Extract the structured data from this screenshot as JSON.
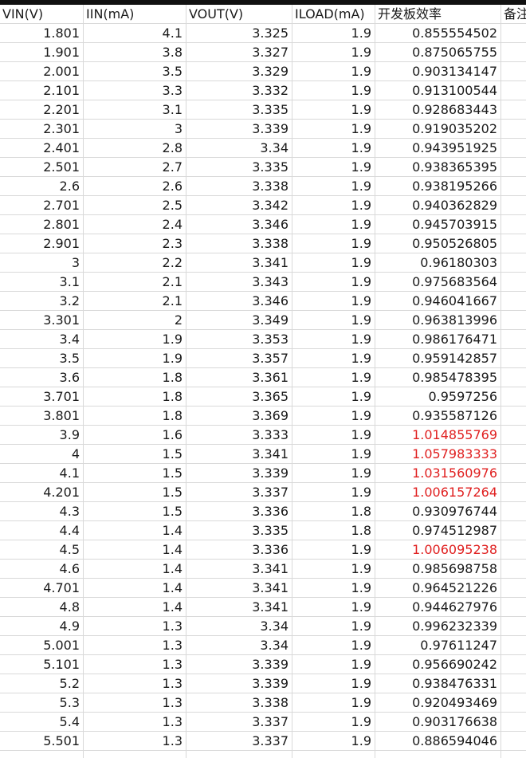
{
  "headers": [
    "VIN(V)",
    "IIN(mA)",
    "VOUT(V)",
    "ILOAD(mA)",
    "开发板效率",
    "备注"
  ],
  "highlight_color": "#e02020",
  "rows": [
    {
      "vin": "1.801",
      "iin": "4.1",
      "vout": "3.325",
      "iload": "1.9",
      "eff": "0.855554502",
      "highlight": false
    },
    {
      "vin": "1.901",
      "iin": "3.8",
      "vout": "3.327",
      "iload": "1.9",
      "eff": "0.875065755",
      "highlight": false
    },
    {
      "vin": "2.001",
      "iin": "3.5",
      "vout": "3.329",
      "iload": "1.9",
      "eff": "0.903134147",
      "highlight": false
    },
    {
      "vin": "2.101",
      "iin": "3.3",
      "vout": "3.332",
      "iload": "1.9",
      "eff": "0.913100544",
      "highlight": false
    },
    {
      "vin": "2.201",
      "iin": "3.1",
      "vout": "3.335",
      "iload": "1.9",
      "eff": "0.928683443",
      "highlight": false
    },
    {
      "vin": "2.301",
      "iin": "3",
      "vout": "3.339",
      "iload": "1.9",
      "eff": "0.919035202",
      "highlight": false
    },
    {
      "vin": "2.401",
      "iin": "2.8",
      "vout": "3.34",
      "iload": "1.9",
      "eff": "0.943951925",
      "highlight": false
    },
    {
      "vin": "2.501",
      "iin": "2.7",
      "vout": "3.335",
      "iload": "1.9",
      "eff": "0.938365395",
      "highlight": false
    },
    {
      "vin": "2.6",
      "iin": "2.6",
      "vout": "3.338",
      "iload": "1.9",
      "eff": "0.938195266",
      "highlight": false
    },
    {
      "vin": "2.701",
      "iin": "2.5",
      "vout": "3.342",
      "iload": "1.9",
      "eff": "0.940362829",
      "highlight": false
    },
    {
      "vin": "2.801",
      "iin": "2.4",
      "vout": "3.346",
      "iload": "1.9",
      "eff": "0.945703915",
      "highlight": false
    },
    {
      "vin": "2.901",
      "iin": "2.3",
      "vout": "3.338",
      "iload": "1.9",
      "eff": "0.950526805",
      "highlight": false
    },
    {
      "vin": "3",
      "iin": "2.2",
      "vout": "3.341",
      "iload": "1.9",
      "eff": "0.96180303",
      "highlight": false
    },
    {
      "vin": "3.1",
      "iin": "2.1",
      "vout": "3.343",
      "iload": "1.9",
      "eff": "0.975683564",
      "highlight": false
    },
    {
      "vin": "3.2",
      "iin": "2.1",
      "vout": "3.346",
      "iload": "1.9",
      "eff": "0.946041667",
      "highlight": false
    },
    {
      "vin": "3.301",
      "iin": "2",
      "vout": "3.349",
      "iload": "1.9",
      "eff": "0.963813996",
      "highlight": false
    },
    {
      "vin": "3.4",
      "iin": "1.9",
      "vout": "3.353",
      "iload": "1.9",
      "eff": "0.986176471",
      "highlight": false
    },
    {
      "vin": "3.5",
      "iin": "1.9",
      "vout": "3.357",
      "iload": "1.9",
      "eff": "0.959142857",
      "highlight": false
    },
    {
      "vin": "3.6",
      "iin": "1.8",
      "vout": "3.361",
      "iload": "1.9",
      "eff": "0.985478395",
      "highlight": false
    },
    {
      "vin": "3.701",
      "iin": "1.8",
      "vout": "3.365",
      "iload": "1.9",
      "eff": "0.9597256",
      "highlight": false
    },
    {
      "vin": "3.801",
      "iin": "1.8",
      "vout": "3.369",
      "iload": "1.9",
      "eff": "0.935587126",
      "highlight": false
    },
    {
      "vin": "3.9",
      "iin": "1.6",
      "vout": "3.333",
      "iload": "1.9",
      "eff": "1.014855769",
      "highlight": true
    },
    {
      "vin": "4",
      "iin": "1.5",
      "vout": "3.341",
      "iload": "1.9",
      "eff": "1.057983333",
      "highlight": true
    },
    {
      "vin": "4.1",
      "iin": "1.5",
      "vout": "3.339",
      "iload": "1.9",
      "eff": "1.031560976",
      "highlight": true
    },
    {
      "vin": "4.201",
      "iin": "1.5",
      "vout": "3.337",
      "iload": "1.9",
      "eff": "1.006157264",
      "highlight": true
    },
    {
      "vin": "4.3",
      "iin": "1.5",
      "vout": "3.336",
      "iload": "1.8",
      "eff": "0.930976744",
      "highlight": false
    },
    {
      "vin": "4.4",
      "iin": "1.4",
      "vout": "3.335",
      "iload": "1.8",
      "eff": "0.974512987",
      "highlight": false
    },
    {
      "vin": "4.5",
      "iin": "1.4",
      "vout": "3.336",
      "iload": "1.9",
      "eff": "1.006095238",
      "highlight": true
    },
    {
      "vin": "4.6",
      "iin": "1.4",
      "vout": "3.341",
      "iload": "1.9",
      "eff": "0.985698758",
      "highlight": false
    },
    {
      "vin": "4.701",
      "iin": "1.4",
      "vout": "3.341",
      "iload": "1.9",
      "eff": "0.964521226",
      "highlight": false
    },
    {
      "vin": "4.8",
      "iin": "1.4",
      "vout": "3.341",
      "iload": "1.9",
      "eff": "0.944627976",
      "highlight": false
    },
    {
      "vin": "4.9",
      "iin": "1.3",
      "vout": "3.34",
      "iload": "1.9",
      "eff": "0.996232339",
      "highlight": false
    },
    {
      "vin": "5.001",
      "iin": "1.3",
      "vout": "3.34",
      "iload": "1.9",
      "eff": "0.97611247",
      "highlight": false
    },
    {
      "vin": "5.101",
      "iin": "1.3",
      "vout": "3.339",
      "iload": "1.9",
      "eff": "0.956690242",
      "highlight": false
    },
    {
      "vin": "5.2",
      "iin": "1.3",
      "vout": "3.339",
      "iload": "1.9",
      "eff": "0.938476331",
      "highlight": false
    },
    {
      "vin": "5.3",
      "iin": "1.3",
      "vout": "3.338",
      "iload": "1.9",
      "eff": "0.920493469",
      "highlight": false
    },
    {
      "vin": "5.4",
      "iin": "1.3",
      "vout": "3.337",
      "iload": "1.9",
      "eff": "0.903176638",
      "highlight": false
    },
    {
      "vin": "5.501",
      "iin": "1.3",
      "vout": "3.337",
      "iload": "1.9",
      "eff": "0.886594046",
      "highlight": false
    }
  ]
}
